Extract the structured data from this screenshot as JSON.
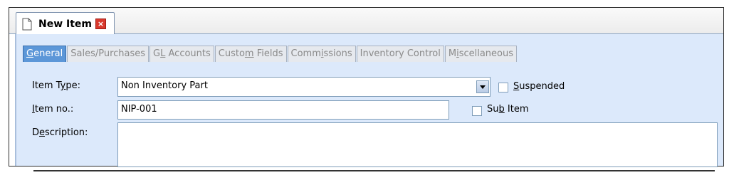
{
  "document_tab": {
    "title": "New Item",
    "close_symbol": "×",
    "icon": "document-icon"
  },
  "subtabs": [
    {
      "pre": "",
      "u": "G",
      "post": "eneral",
      "active": true
    },
    {
      "pre": "",
      "u": "",
      "post": "Sales/Purchases",
      "active": false
    },
    {
      "pre": "G",
      "u": "L",
      "post": " Accounts",
      "active": false
    },
    {
      "pre": "Custo",
      "u": "m",
      "post": " Fields",
      "active": false
    },
    {
      "pre": "Comm",
      "u": "i",
      "post": "ssions",
      "active": false
    },
    {
      "pre": "",
      "u": "",
      "post": "Inventory Control",
      "active": false
    },
    {
      "pre": "M",
      "u": "i",
      "post": "scellaneous",
      "active": false
    }
  ],
  "form": {
    "item_type": {
      "pre": "Item T",
      "u": "y",
      "post": "pe:",
      "value": "Non Inventory Part"
    },
    "suspended": {
      "u": "S",
      "post": "uspended",
      "checked": false
    },
    "item_no": {
      "u": "I",
      "post": "tem no.:",
      "value": "NIP-001"
    },
    "sub_item": {
      "pre": "Su",
      "u": "b",
      "post": " Item",
      "checked": false
    },
    "description": {
      "pre": "D",
      "u": "e",
      "post": "scription:",
      "value": ""
    }
  },
  "colors": {
    "panel": "#dce9fb",
    "active_tab": "#5c97d8",
    "close_button": "#d9382d"
  }
}
